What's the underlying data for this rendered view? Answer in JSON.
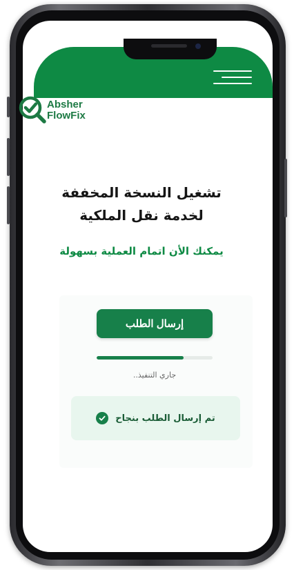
{
  "logo": {
    "line1": "Absher",
    "line2": "FlowFix"
  },
  "content": {
    "title_line1": "تشغيل النسخة المخففة",
    "title_line2": "لخدمة نقل الملكية",
    "subtitle": "يمكنك الأن اتمام العملية بسهولة"
  },
  "action": {
    "submit_label": "إرسال الطلب",
    "progress_percent": 75,
    "status_text": "جاري التنفيذ.."
  },
  "success": {
    "message": "تم إرسال الطلب بنجاح"
  },
  "colors": {
    "brand_green": "#0e8a44",
    "button_green": "#17804a",
    "success_bg": "#e8f6ee"
  },
  "icons": {
    "menu": "hamburger-menu-icon",
    "logo": "magnifier-check-icon",
    "success": "check-circle-icon"
  }
}
